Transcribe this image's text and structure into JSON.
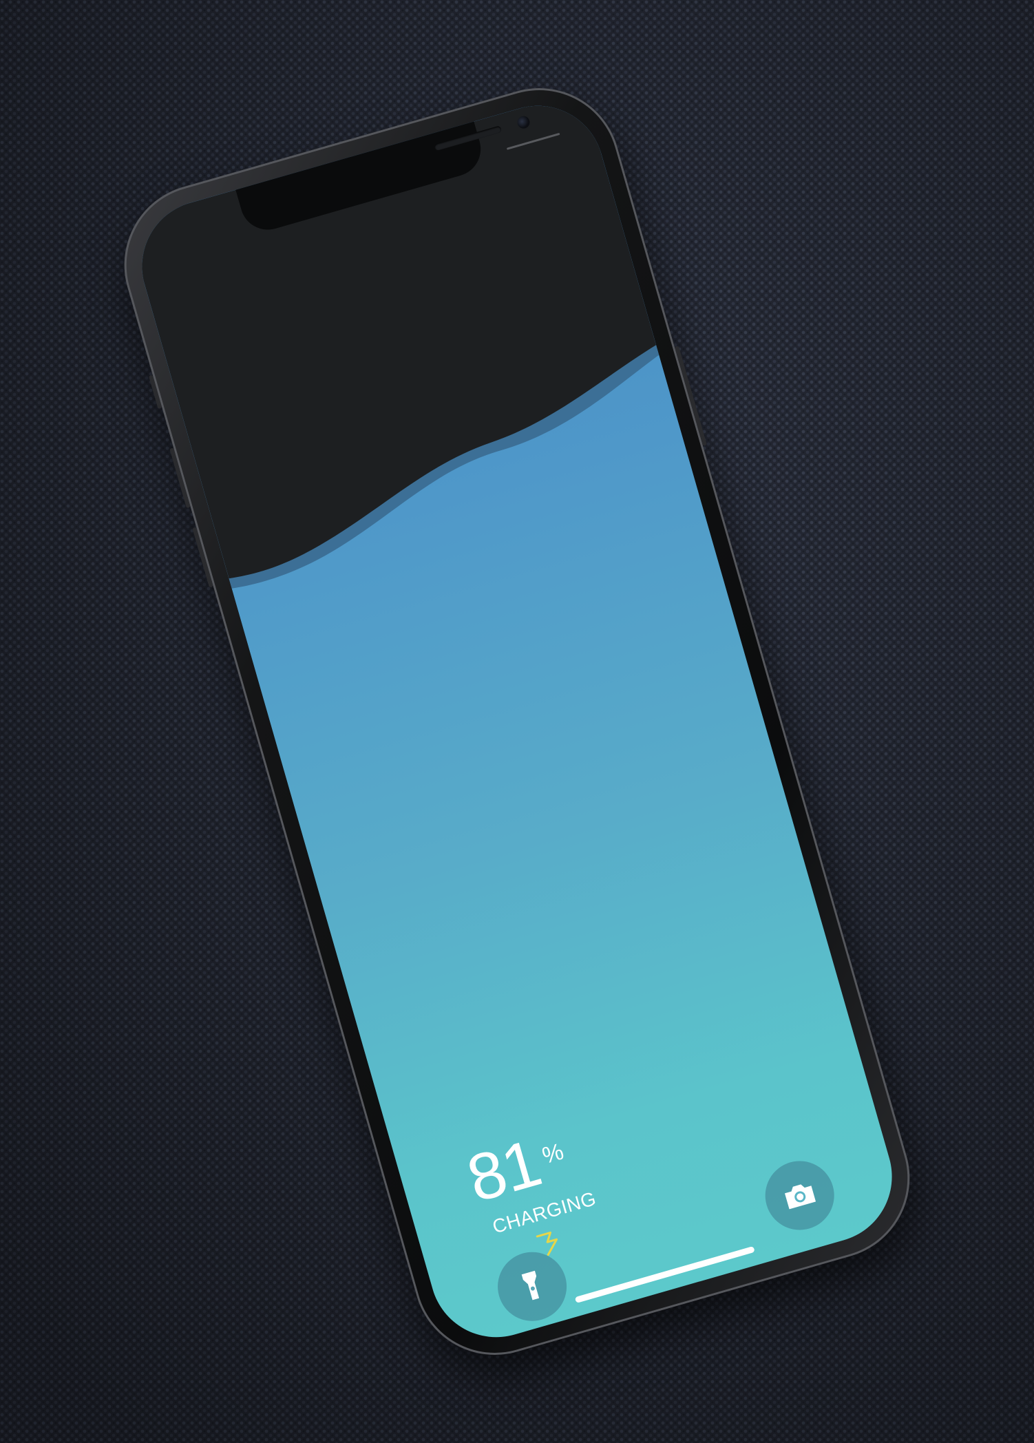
{
  "lock_screen": {
    "battery_percent": "81",
    "percent_sign": "%",
    "status_label": "CHARGING",
    "charge_level": 0.81
  },
  "icons": {
    "bolt": "lightning-bolt-icon",
    "flashlight": "flashlight-icon",
    "camera": "camera-icon"
  },
  "colors": {
    "gradient_top": "#4589c5",
    "gradient_bottom": "#5cc9cb",
    "empty_area": "#1d1f21",
    "bolt": "#e6d64a",
    "fabric": "#2a2f3c"
  }
}
